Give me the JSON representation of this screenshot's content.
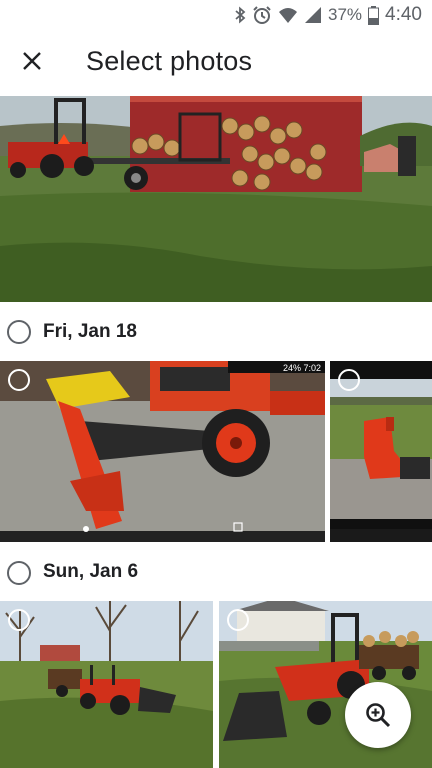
{
  "status_bar": {
    "battery_percent": "37%",
    "time": "4:40",
    "icons": [
      "bluetooth-icon",
      "alarm-icon",
      "wifi-icon",
      "signal-icon",
      "battery-icon"
    ]
  },
  "app_bar": {
    "close_icon": "close-icon",
    "title": "Select photos"
  },
  "sections": [
    {
      "date": "Fri, Jan 18"
    },
    {
      "date": "Sun, Jan 6"
    }
  ],
  "screenshot_overlay": {
    "battery": "24%",
    "time": "7:02"
  },
  "fab": {
    "icon": "zoom-in-icon"
  },
  "colors": {
    "accent": "#202124",
    "icon_gray": "#5f6368",
    "tractor_orange": "#d9401f"
  }
}
